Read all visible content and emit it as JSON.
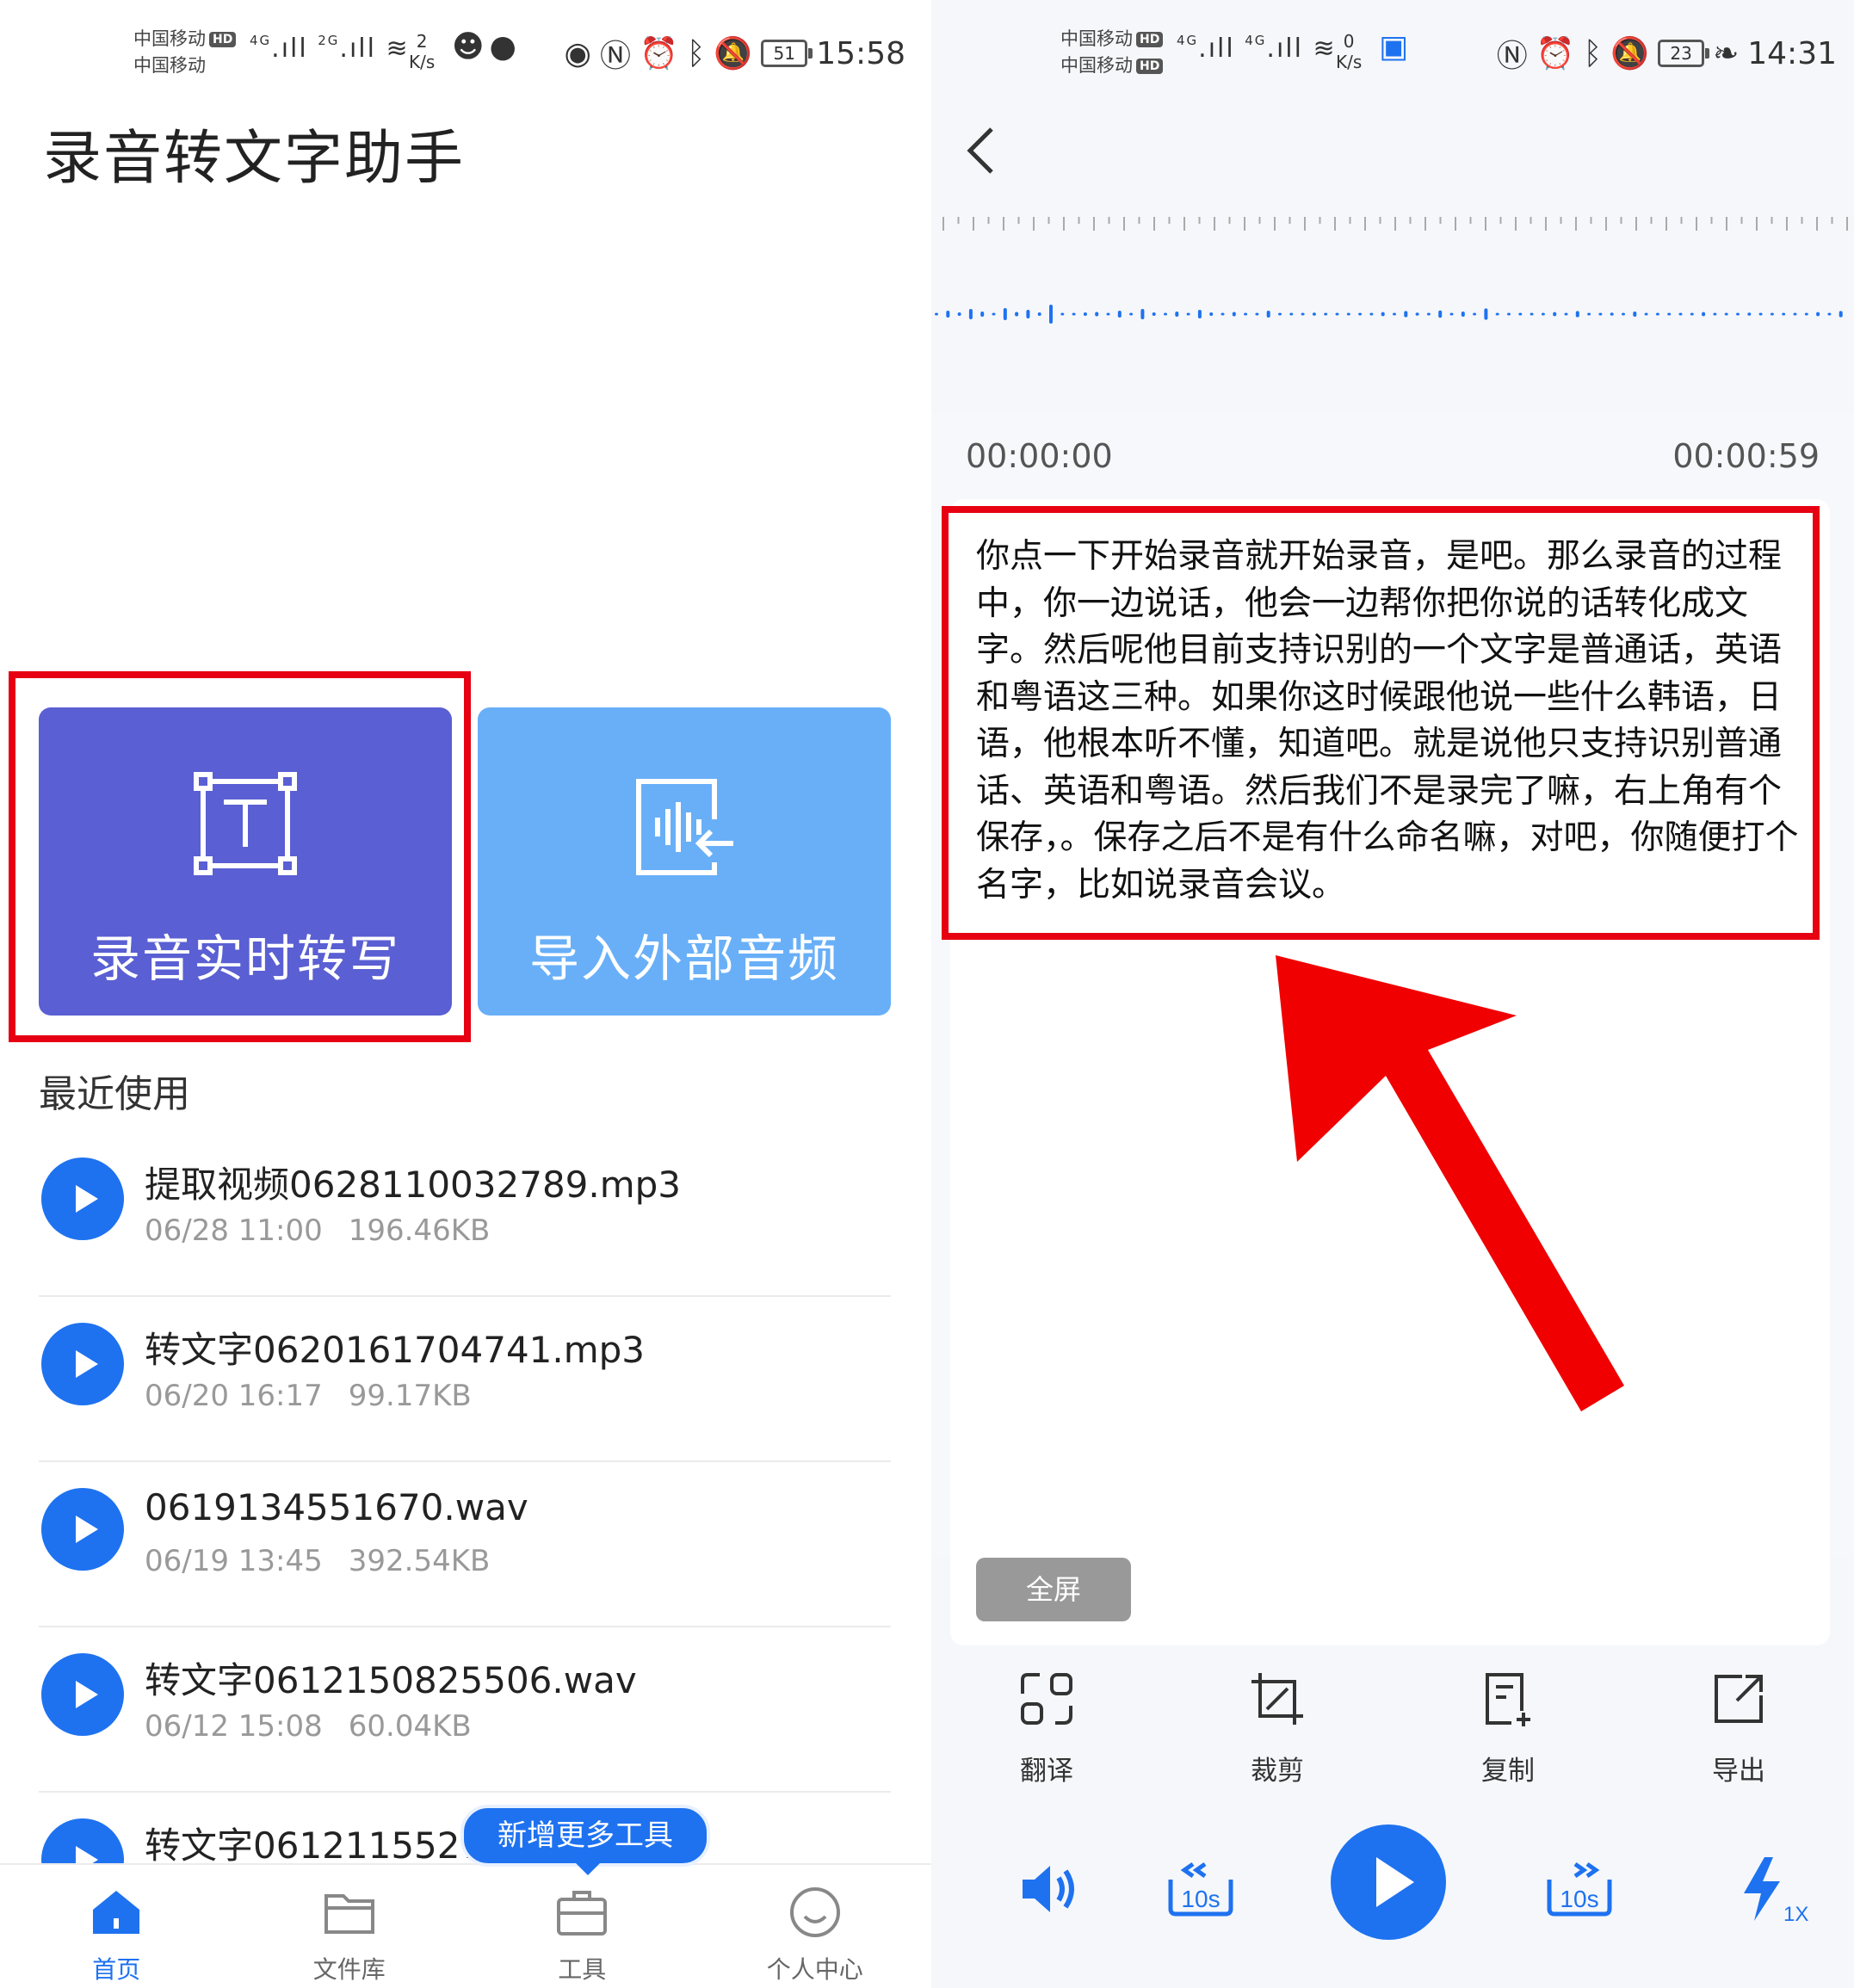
{
  "left": {
    "status": {
      "carrier1": "中国移动",
      "carrier2": "中国移动",
      "hd": "HD",
      "net1": "4G",
      "net2": "2G",
      "speed_value": "2",
      "speed_unit": "K/s",
      "battery": "51",
      "time": "15:58"
    },
    "app_title": "录音转文字助手",
    "cards": {
      "record_label": "录音实时转写",
      "import_label": "导入外部音频"
    },
    "recent_title": "最近使用",
    "files": [
      {
        "name": "提取视频0628110032789.mp3",
        "date": "06/28 11:00",
        "size": "196.46KB"
      },
      {
        "name": "转文字0620161704741.mp3",
        "date": "06/20 16:17",
        "size": "99.17KB"
      },
      {
        "name": "0619134551670.wav",
        "date": "06/19 13:45",
        "size": "392.54KB"
      },
      {
        "name": "转文字0612150825506.wav",
        "date": "06/12 15:08",
        "size": "60.04KB"
      },
      {
        "name": "转文字06121155270",
        "date": "",
        "size": ""
      }
    ],
    "tooltip": "新增更多工具",
    "nav": [
      {
        "label": "首页",
        "icon": "home-icon",
        "active": true
      },
      {
        "label": "文件库",
        "icon": "folder-icon",
        "active": false
      },
      {
        "label": "工具",
        "icon": "toolbox-icon",
        "active": false
      },
      {
        "label": "个人中心",
        "icon": "smile-icon",
        "active": false
      }
    ]
  },
  "right": {
    "status": {
      "carrier1": "中国移动",
      "carrier2": "中国移动",
      "hd": "HD",
      "net1": "4G",
      "net2": "4G",
      "speed_value": "0",
      "speed_unit": "K/s",
      "battery": "23",
      "time": "14:31"
    },
    "time_start": "00:00:00",
    "time_end": "00:00:59",
    "transcript": "你点一下开始录音就开始录音，是吧。那么录音的过程中，你一边说话，他会一边帮你把你说的话转化成文字。然后呢他目前支持识别的一个文字是普通话，英语和粤语这三种。如果你这时候跟他说一些什么韩语，日语，他根本听不懂，知道吧。就是说他只支持识别普通话、英语和粤语。然后我们不是录完了嘛，右上角有个保存，。保存之后不是有什么命名嘛，对吧，你随便打个名字，比如说录音会议。",
    "fullscreen": "全屏",
    "tools": [
      {
        "label": "翻译",
        "icon": "translate-icon"
      },
      {
        "label": "裁剪",
        "icon": "crop-icon"
      },
      {
        "label": "复制",
        "icon": "copy-icon"
      },
      {
        "label": "导出",
        "icon": "export-icon"
      }
    ],
    "controls": {
      "rewind": "10s",
      "forward": "10s",
      "speed": "1X"
    }
  },
  "colors": {
    "accent": "#1e72f0",
    "record_card": "#5a5fd3",
    "import_card": "#68aff8",
    "highlight": "#e60012"
  }
}
